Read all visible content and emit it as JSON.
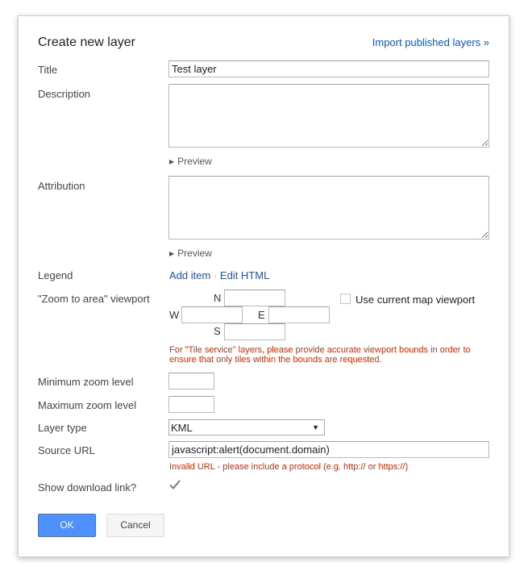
{
  "dialog": {
    "title": "Create new layer",
    "import_link": "Import published layers »"
  },
  "fields": {
    "title_label": "Title",
    "title_value": "Test layer",
    "description_label": "Description",
    "description_value": "",
    "attribution_label": "Attribution",
    "attribution_value": "",
    "preview_label": "Preview",
    "legend_label": "Legend",
    "legend_add_item": "Add item",
    "legend_separator": "·",
    "legend_edit_html": "Edit HTML",
    "viewport_label": "\"Zoom to area\" viewport",
    "viewport_n": "N",
    "viewport_w": "W",
    "viewport_e": "E",
    "viewport_s": "S",
    "viewport_n_value": "",
    "viewport_w_value": "",
    "viewport_e_value": "",
    "viewport_s_value": "",
    "use_current_viewport_label": "Use current map viewport",
    "use_current_viewport_checked": false,
    "tile_service_warning": "For \"Tile service\" layers, please provide accurate viewport bounds in order to ensure that only tiles within the bounds are requested.",
    "min_zoom_label": "Minimum zoom level",
    "min_zoom_value": "",
    "max_zoom_label": "Maximum zoom level",
    "max_zoom_value": "",
    "layer_type_label": "Layer type",
    "layer_type_value": "KML",
    "source_url_label": "Source URL",
    "source_url_value": "javascript:alert(document.domain)",
    "source_url_error": "Invalid URL - please include a protocol (e.g. http:// or https://)",
    "show_download_label": "Show download link?",
    "show_download_checked": true
  },
  "buttons": {
    "ok_label": "OK",
    "cancel_label": "Cancel"
  },
  "icons": {
    "preview_triangle": "triangle-right-icon",
    "dropdown_arrow": "triangle-down-icon",
    "checkmark": "checkmark-icon"
  },
  "colors": {
    "link": "#1155cc",
    "warning": "#dd2c00",
    "ok_button": "#4d90fe"
  }
}
